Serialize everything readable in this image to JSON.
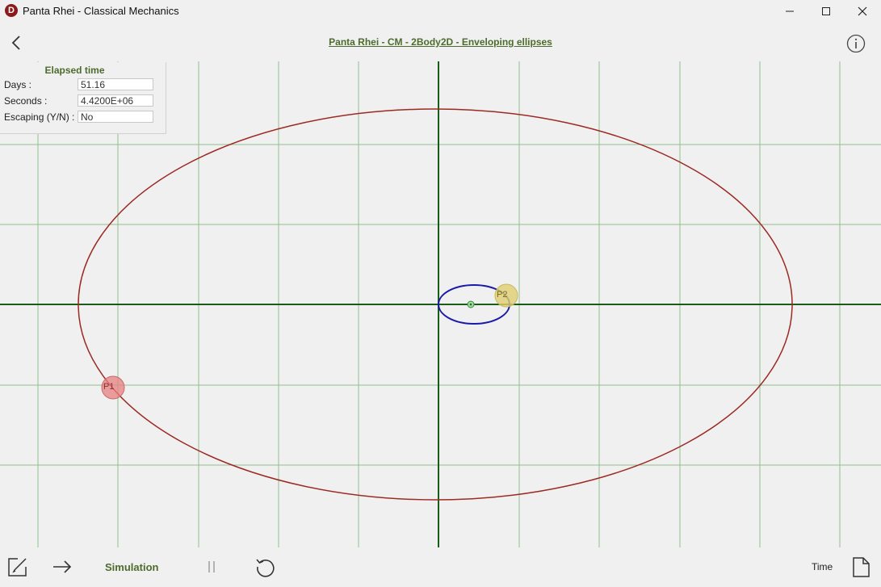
{
  "window": {
    "app_icon_letter": "D",
    "title": "Panta Rhei - Classical Mechanics"
  },
  "header": {
    "title": "Panta Rhei - CM - 2Body2D - Enveloping ellipses"
  },
  "elapsed_panel": {
    "title": "Elapsed time",
    "days_label": "Days :",
    "days_value": "51.16",
    "seconds_label": "Seconds :",
    "seconds_value": "4.4200E+06",
    "escaping_label": "Escaping (Y/N) :",
    "escaping_value": "No"
  },
  "simulation": {
    "body1_label": "P1",
    "body2_label": "P2",
    "colors": {
      "grid": "#8fbf8f",
      "axis": "#1a5c1a",
      "orbit_p1": "#9b2a22",
      "orbit_p2": "#1a1aa8",
      "body_p1": "#e88080",
      "body_p2": "#e0d070",
      "center": "#60c060"
    }
  },
  "toolbar": {
    "edit_icon": "edit-icon",
    "run_icon": "arrow-right-icon",
    "mode_label": "Simulation",
    "pause_icon": "pause-icon",
    "reset_icon": "reset-icon",
    "time_label": "Time",
    "document_icon": "document-icon"
  }
}
